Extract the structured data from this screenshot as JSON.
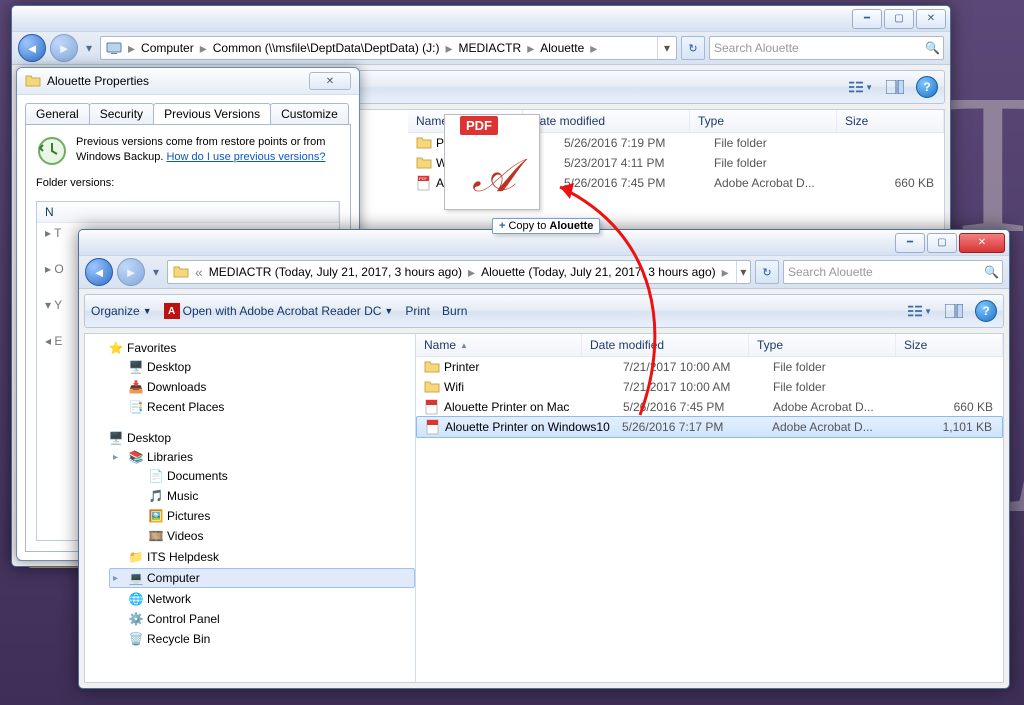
{
  "top_window": {
    "breadcrumb": [
      "Computer",
      "Common (\\\\msfile\\DeptData\\DeptData) (J:)",
      "MEDIACTR",
      "Alouette"
    ],
    "search_placeholder": "Search Alouette",
    "columns": {
      "name": "Name",
      "date": "Date modified",
      "type": "Type",
      "size": "Size"
    },
    "rows": [
      {
        "icon": "folder",
        "name": "Printer",
        "date": "5/26/2016 7:19 PM",
        "type": "File folder",
        "size": ""
      },
      {
        "icon": "folder",
        "name": "Wifi",
        "date": "5/23/2017 4:11 PM",
        "type": "File folder",
        "size": ""
      },
      {
        "icon": "pdf",
        "name": "Alouette Printer …",
        "date": "5/26/2016 7:45 PM",
        "type": "Adobe Acrobat D...",
        "size": "660 KB"
      }
    ]
  },
  "properties": {
    "title": "Alouette Properties",
    "tabs": [
      "General",
      "Security",
      "Previous Versions",
      "Customize"
    ],
    "active_tab": 2,
    "info_text_1": "Previous versions come from restore points or from Windows Backup. ",
    "info_link": "How do I use previous versions?",
    "folder_versions_label": "Folder versions:",
    "ver_col_name": "N",
    "tree_items": [
      "T",
      "O",
      "Y",
      "E"
    ]
  },
  "second_window": {
    "breadcrumb": [
      "MEDIACTR (Today, July 21, 2017, 3 hours ago)",
      "Alouette (Today, July 21, 2017, 3 hours ago)"
    ],
    "search_placeholder": "Search Alouette",
    "toolbar": {
      "organize": "Organize",
      "open_with": "Open with Adobe Acrobat Reader DC",
      "print": "Print",
      "burn": "Burn"
    },
    "columns": {
      "name": "Name",
      "date": "Date modified",
      "type": "Type",
      "size": "Size"
    },
    "favorites_label": "Favorites",
    "favorites": [
      "Desktop",
      "Downloads",
      "Recent Places"
    ],
    "desktop_label": "Desktop",
    "libs_label": "Libraries",
    "libs": [
      "Documents",
      "Music",
      "Pictures",
      "Videos"
    ],
    "more": [
      "ITS Helpdesk",
      "Computer",
      "Network",
      "Control Panel",
      "Recycle Bin"
    ],
    "selected_side": "Computer",
    "rows": [
      {
        "icon": "folder",
        "name": "Printer",
        "date": "7/21/2017 10:00 AM",
        "type": "File folder",
        "size": ""
      },
      {
        "icon": "folder",
        "name": "Wifi",
        "date": "7/21/2017 10:00 AM",
        "type": "File folder",
        "size": ""
      },
      {
        "icon": "pdf",
        "name": "Alouette Printer on Mac",
        "date": "5/26/2016 7:45 PM",
        "type": "Adobe Acrobat D...",
        "size": "660 KB"
      },
      {
        "icon": "pdf",
        "name": "Alouette Printer on Windows10",
        "date": "5/26/2016 7:17 PM",
        "type": "Adobe Acrobat D...",
        "size": "1,101 KB",
        "selected": true
      }
    ]
  },
  "drag": {
    "pdf_badge": "PDF",
    "hint_prefix": "+",
    "hint_text": "Copy to ",
    "hint_target": "Alouette"
  }
}
